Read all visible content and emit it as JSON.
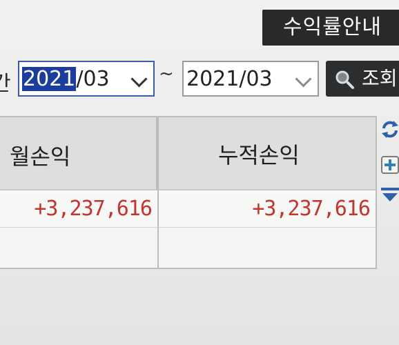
{
  "header": {
    "info_button_label": "수익률안내"
  },
  "filter": {
    "period_label_partial": "간",
    "start_date": {
      "selected_part": "2021",
      "rest": "/03"
    },
    "separator": "~",
    "end_date": "2021/03",
    "search_button_label": "조회"
  },
  "table": {
    "columns": [
      {
        "label": "월손익"
      },
      {
        "label": "누적손익"
      }
    ],
    "rows": [
      {
        "monthly_pnl": "+3,237,616",
        "cumulative_pnl": "+3,237,616"
      }
    ]
  },
  "colors": {
    "positive_value": "#c0352f",
    "dark_button": "#27292a",
    "selection": "#1b3d9c"
  },
  "icons": {
    "refresh": "refresh-icon",
    "add": "add-icon",
    "down": "triangle-down-icon",
    "search": "magnifier-icon"
  }
}
